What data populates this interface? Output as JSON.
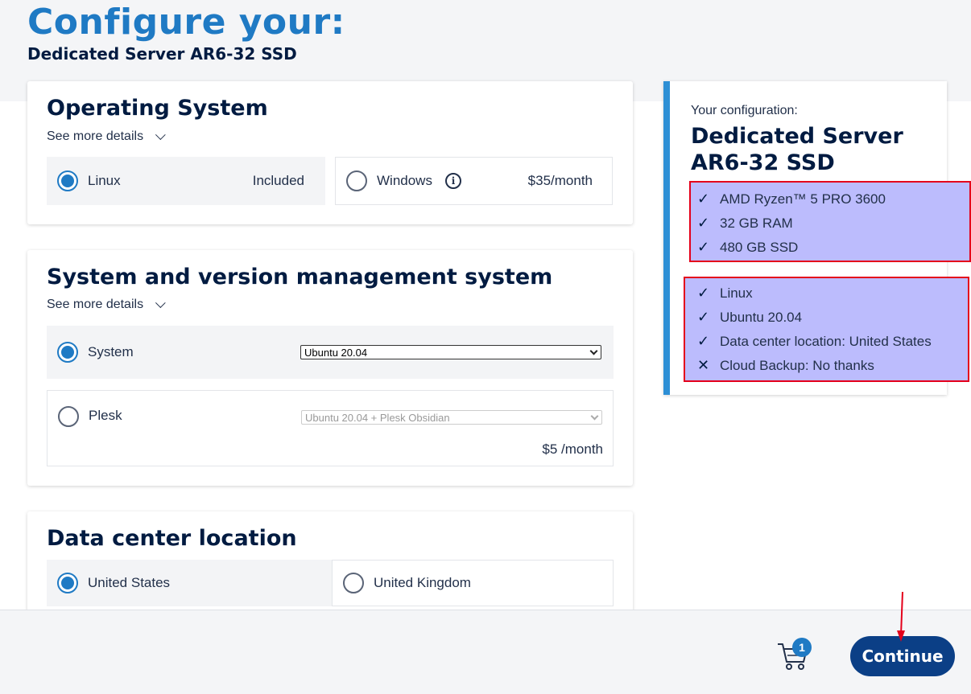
{
  "header": {
    "title": "Configure your:",
    "subtitle": "Dedicated Server AR6-32 SSD"
  },
  "os_section": {
    "title": "Operating System",
    "details_link": "See more details",
    "options": [
      {
        "label": "Linux",
        "price": "Included",
        "selected": true
      },
      {
        "label": "Windows",
        "price": "$35/month",
        "selected": false
      }
    ]
  },
  "mgmt_section": {
    "title": "System and version management system",
    "details_link": "See more details",
    "options": [
      {
        "label": "System",
        "select_value": "Ubuntu 20.04",
        "selected": true
      },
      {
        "label": "Plesk",
        "select_value": "Ubuntu 20.04 + Plesk Obsidian",
        "price": "$5 /month",
        "selected": false
      }
    ]
  },
  "dc_section": {
    "title": "Data center location",
    "options": [
      {
        "label": "United States",
        "selected": true
      },
      {
        "label": "United Kingdom",
        "selected": false
      }
    ]
  },
  "summary": {
    "label": "Your configuration:",
    "title": "Dedicated Server AR6-32 SSD",
    "hardware": [
      "AMD Ryzen™ 5 PRO 3600",
      "32 GB RAM",
      "480 GB SSD"
    ],
    "options": [
      {
        "text": "Linux",
        "mark": "✓"
      },
      {
        "text": "Ubuntu 20.04",
        "mark": "✓"
      },
      {
        "text": "Data center location: United States",
        "mark": "✓"
      },
      {
        "text": "Cloud Backup: No thanks",
        "mark": "✕"
      }
    ]
  },
  "footer": {
    "cart_count": "1",
    "continue_label": "Continue"
  },
  "colors": {
    "accent": "#1f7ac4",
    "primary_button": "#0b3f86",
    "highlight_fill": "#bcbcfd",
    "highlight_border": "#e4001b"
  }
}
